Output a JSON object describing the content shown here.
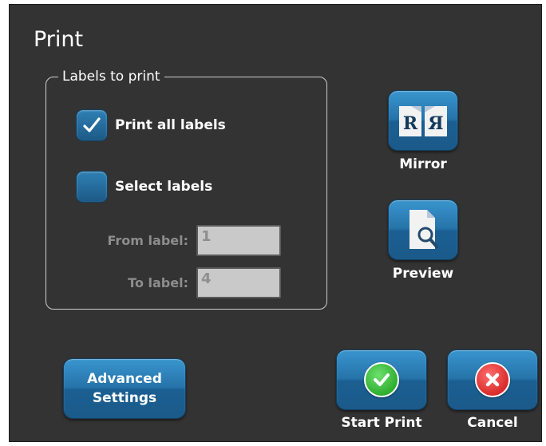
{
  "dialog": {
    "title": "Print"
  },
  "labels_group": {
    "legend": "Labels to print",
    "options": [
      {
        "label": "Print all labels",
        "checked": true
      },
      {
        "label": "Select labels",
        "checked": false
      }
    ],
    "from_label": {
      "label": "From label:",
      "value": "1"
    },
    "to_label": {
      "label": "To label:",
      "value": "4"
    }
  },
  "mirror": {
    "label": "Mirror",
    "icon": "mirror-icon",
    "glyph_left": "R",
    "glyph_right": "Я"
  },
  "preview": {
    "label": "Preview",
    "icon": "document-preview-icon"
  },
  "advanced": {
    "line1": "Advanced",
    "line2": "Settings"
  },
  "start_print": {
    "label": "Start Print",
    "icon": "green-check-icon",
    "color": "#3cba3c"
  },
  "cancel": {
    "label": "Cancel",
    "icon": "red-x-icon",
    "color": "#e23a3a"
  },
  "colors": {
    "dialog_bg": "#333333",
    "button_blue": "#2573a9"
  }
}
